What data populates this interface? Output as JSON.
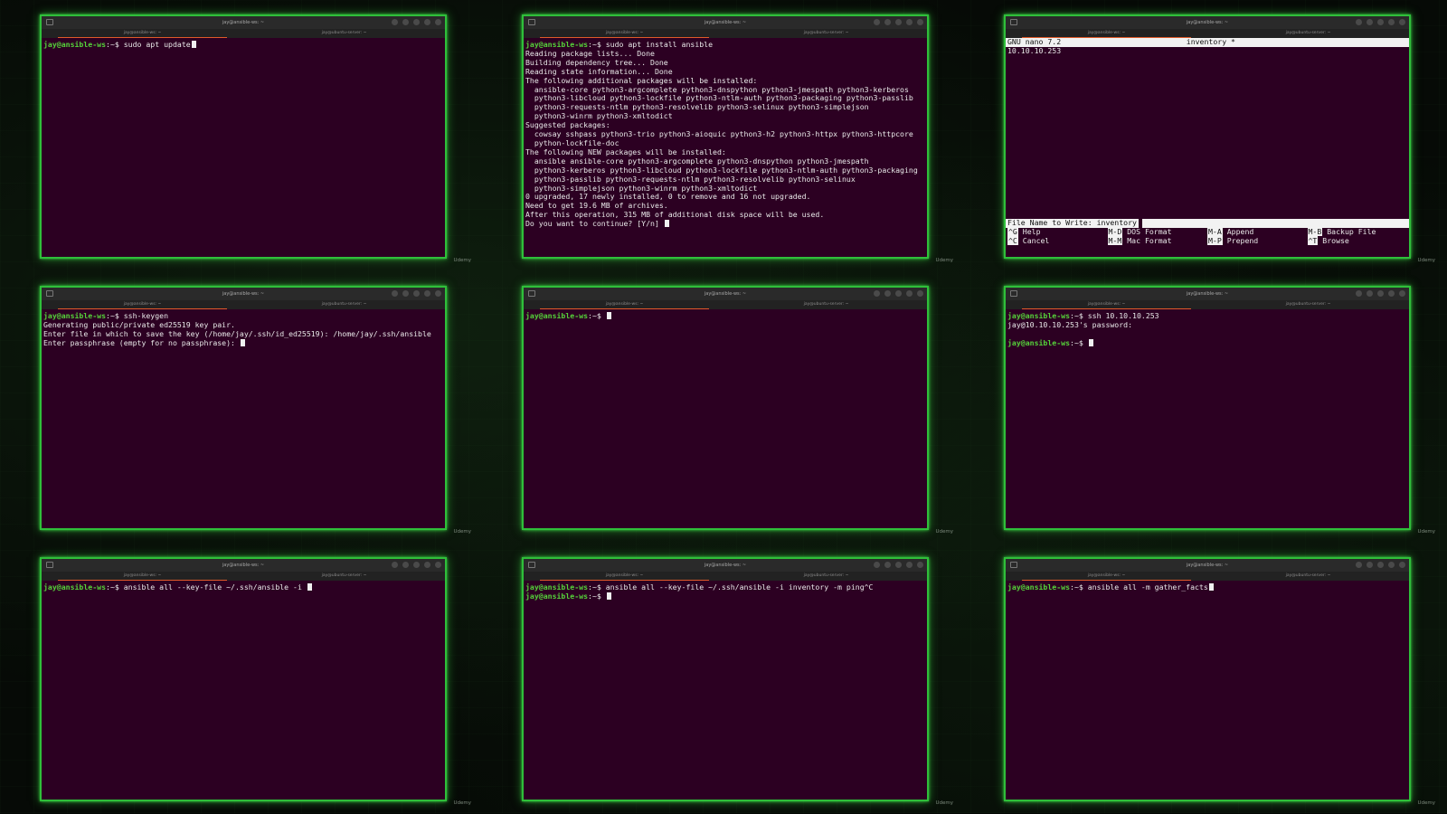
{
  "brand": "Udemy",
  "cells": [
    {
      "title": "jay@ansible-ws: ~",
      "tabs": [
        "jay@ansible-ws: ~",
        "jay@ubuntu-server: ~"
      ],
      "lines": [
        {
          "prompt": "jay@ansible-ws",
          "text": ":~$ sudo apt update",
          "cursor": true
        }
      ]
    },
    {
      "title": "jay@ansible-ws: ~",
      "tabs": [
        "jay@ansible-ws: ~",
        "jay@ubuntu-server: ~"
      ],
      "lines": [
        {
          "prompt": "jay@ansible-ws",
          "text": ":~$ sudo apt install ansible"
        },
        {
          "text": "Reading package lists... Done"
        },
        {
          "text": "Building dependency tree... Done"
        },
        {
          "text": "Reading state information... Done"
        },
        {
          "text": "The following additional packages will be installed:"
        },
        {
          "text": "  ansible-core python3-argcomplete python3-dnspython python3-jmespath python3-kerberos"
        },
        {
          "text": "  python3-libcloud python3-lockfile python3-ntlm-auth python3-packaging python3-passlib"
        },
        {
          "text": "  python3-requests-ntlm python3-resolvelib python3-selinux python3-simplejson"
        },
        {
          "text": "  python3-winrm python3-xmltodict"
        },
        {
          "text": "Suggested packages:"
        },
        {
          "text": "  cowsay sshpass python3-trio python3-aioquic python3-h2 python3-httpx python3-httpcore"
        },
        {
          "text": "  python-lockfile-doc"
        },
        {
          "text": "The following NEW packages will be installed:"
        },
        {
          "text": "  ansible ansible-core python3-argcomplete python3-dnspython python3-jmespath"
        },
        {
          "text": "  python3-kerberos python3-libcloud python3-lockfile python3-ntlm-auth python3-packaging"
        },
        {
          "text": "  python3-passlib python3-requests-ntlm python3-resolvelib python3-selinux"
        },
        {
          "text": "  python3-simplejson python3-winrm python3-xmltodict"
        },
        {
          "text": "0 upgraded, 17 newly installed, 0 to remove and 16 not upgraded."
        },
        {
          "text": "Need to get 19.6 MB of archives."
        },
        {
          "text": "After this operation, 315 MB of additional disk space will be used."
        },
        {
          "text": "Do you want to continue? [Y/n] ",
          "cursor": true
        }
      ]
    },
    {
      "title": "jay@ansible-ws: ~",
      "tabs": [
        "jay@ansible-ws: ~",
        "jay@ubuntu-server: ~"
      ],
      "nano": {
        "app": "GNU nano 7.2",
        "file": "inventory *",
        "body": [
          "10.10.10.253"
        ],
        "write_label": "File Name to Write: inventory",
        "keys": [
          {
            "key": "^G",
            "label": " Help"
          },
          {
            "key": "M-D",
            "label": " DOS Format"
          },
          {
            "key": "M-A",
            "label": " Append"
          },
          {
            "key": "M-B",
            "label": " Backup File"
          },
          {
            "key": "^C",
            "label": " Cancel"
          },
          {
            "key": "M-M",
            "label": " Mac Format"
          },
          {
            "key": "M-P",
            "label": " Prepend"
          },
          {
            "key": "^T",
            "label": " Browse"
          }
        ]
      }
    },
    {
      "title": "jay@ansible-ws: ~",
      "tabs": [
        "jay@ansible-ws: ~",
        "jay@ubuntu-server: ~"
      ],
      "lines": [
        {
          "prompt": "jay@ansible-ws",
          "text": ":~$ ssh-keygen"
        },
        {
          "text": "Generating public/private ed25519 key pair."
        },
        {
          "text": "Enter file in which to save the key (/home/jay/.ssh/id_ed25519): /home/jay/.ssh/ansible"
        },
        {
          "text": "Enter passphrase (empty for no passphrase): ",
          "cursor": true
        }
      ]
    },
    {
      "title": "jay@ansible-ws: ~",
      "tabs": [
        "jay@ansible-ws: ~",
        "jay@ubuntu-server: ~"
      ],
      "lines": [
        {
          "prompt": "jay@ansible-ws",
          "text": ":~$ ",
          "cursor": true
        }
      ]
    },
    {
      "title": "jay@ansible-ws: ~",
      "tabs": [
        "jay@ansible-ws: ~",
        "jay@ubuntu-server: ~"
      ],
      "lines": [
        {
          "prompt": "jay@ansible-ws",
          "text": ":~$ ssh 10.10.10.253"
        },
        {
          "text": "jay@10.10.10.253's password:"
        },
        {
          "text": ""
        },
        {
          "prompt": "jay@ansible-ws",
          "text": ":~$ ",
          "cursor": true
        }
      ]
    },
    {
      "title": "jay@ansible-ws: ~",
      "tabs": [
        "jay@ansible-ws: ~",
        "jay@ubuntu-server: ~"
      ],
      "lines": [
        {
          "prompt": "jay@ansible-ws",
          "text": ":~$ ansible all --key-file ~/.ssh/ansible -i ",
          "cursor": true
        }
      ]
    },
    {
      "title": "jay@ansible-ws: ~",
      "tabs": [
        "jay@ansible-ws: ~",
        "jay@ubuntu-server: ~"
      ],
      "lines": [
        {
          "prompt": "jay@ansible-ws",
          "text": ":~$ ansible all --key-file ~/.ssh/ansible -i inventory -m ping^C"
        },
        {
          "prompt": "jay@ansible-ws",
          "text": ":~$ ",
          "cursor": true
        }
      ]
    },
    {
      "title": "jay@ansible-ws: ~",
      "tabs": [
        "jay@ansible-ws: ~",
        "jay@ubuntu-server: ~"
      ],
      "lines": [
        {
          "prompt": "jay@ansible-ws",
          "text": ":~$ ansible all -m gather_facts",
          "cursor": true
        }
      ]
    }
  ]
}
